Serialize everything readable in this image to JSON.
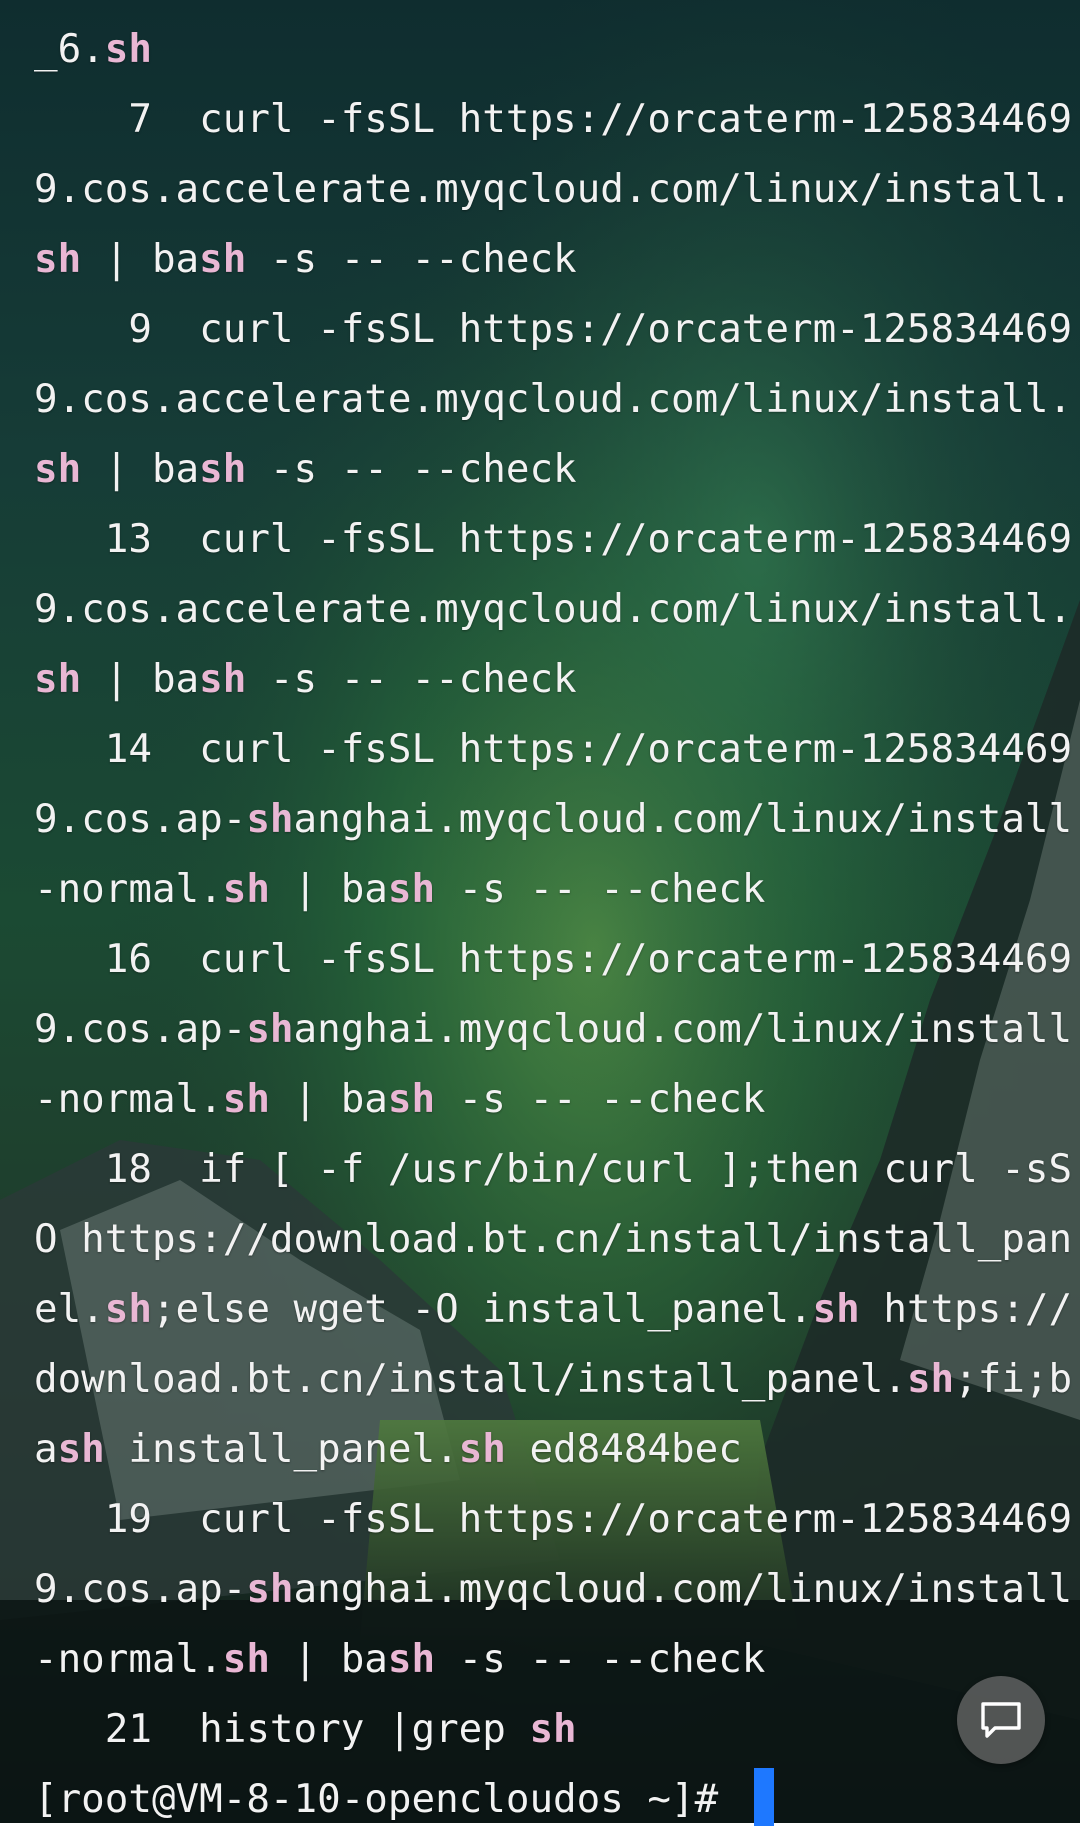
{
  "terminal": {
    "lines": [
      [
        {
          "t": "_6."
        },
        {
          "t": "sh",
          "hl": true
        }
      ],
      [
        {
          "t": "    7  curl -fsSL https://orcaterm-125834469"
        }
      ],
      [
        {
          "t": "9.cos.accelerate.myqcloud.com/linux/install."
        }
      ],
      [
        {
          "t": "sh",
          "hl": true
        },
        {
          "t": " | ba"
        },
        {
          "t": "sh",
          "hl": true
        },
        {
          "t": " -s -- --check"
        }
      ],
      [
        {
          "t": "    9  curl -fsSL https://orcaterm-125834469"
        }
      ],
      [
        {
          "t": "9.cos.accelerate.myqcloud.com/linux/install."
        }
      ],
      [
        {
          "t": "sh",
          "hl": true
        },
        {
          "t": " | ba"
        },
        {
          "t": "sh",
          "hl": true
        },
        {
          "t": " -s -- --check"
        }
      ],
      [
        {
          "t": "   13  curl -fsSL https://orcaterm-125834469"
        }
      ],
      [
        {
          "t": "9.cos.accelerate.myqcloud.com/linux/install."
        }
      ],
      [
        {
          "t": "sh",
          "hl": true
        },
        {
          "t": " | ba"
        },
        {
          "t": "sh",
          "hl": true
        },
        {
          "t": " -s -- --check"
        }
      ],
      [
        {
          "t": "   14  curl -fsSL https://orcaterm-125834469"
        }
      ],
      [
        {
          "t": "9.cos.ap-"
        },
        {
          "t": "sh",
          "hl": true
        },
        {
          "t": "anghai.myqcloud.com/linux/install"
        }
      ],
      [
        {
          "t": "-normal."
        },
        {
          "t": "sh",
          "hl": true
        },
        {
          "t": " | ba"
        },
        {
          "t": "sh",
          "hl": true
        },
        {
          "t": " -s -- --check"
        }
      ],
      [
        {
          "t": "   16  curl -fsSL https://orcaterm-125834469"
        }
      ],
      [
        {
          "t": "9.cos.ap-"
        },
        {
          "t": "sh",
          "hl": true
        },
        {
          "t": "anghai.myqcloud.com/linux/install"
        }
      ],
      [
        {
          "t": "-normal."
        },
        {
          "t": "sh",
          "hl": true
        },
        {
          "t": " | ba"
        },
        {
          "t": "sh",
          "hl": true
        },
        {
          "t": " -s -- --check"
        }
      ],
      [
        {
          "t": "   18  if [ -f /usr/bin/curl ];then curl -sS"
        }
      ],
      [
        {
          "t": "O https://download.bt.cn/install/install_pan"
        }
      ],
      [
        {
          "t": "el."
        },
        {
          "t": "sh",
          "hl": true
        },
        {
          "t": ";else wget -O install_panel."
        },
        {
          "t": "sh",
          "hl": true
        },
        {
          "t": " https://"
        }
      ],
      [
        {
          "t": "download.bt.cn/install/install_panel."
        },
        {
          "t": "sh",
          "hl": true
        },
        {
          "t": ";fi;b"
        }
      ],
      [
        {
          "t": "a"
        },
        {
          "t": "sh",
          "hl": true
        },
        {
          "t": " install_panel."
        },
        {
          "t": "sh",
          "hl": true
        },
        {
          "t": " ed8484bec"
        }
      ],
      [
        {
          "t": "   19  curl -fsSL https://orcaterm-125834469"
        }
      ],
      [
        {
          "t": "9.cos.ap-"
        },
        {
          "t": "sh",
          "hl": true
        },
        {
          "t": "anghai.myqcloud.com/linux/install"
        }
      ],
      [
        {
          "t": "-normal."
        },
        {
          "t": "sh",
          "hl": true
        },
        {
          "t": " | ba"
        },
        {
          "t": "sh",
          "hl": true
        },
        {
          "t": " -s -- --check"
        }
      ],
      [
        {
          "t": "   21  history |grep "
        },
        {
          "t": "sh",
          "hl": true
        }
      ]
    ],
    "prompt": "[root@VM-8-10-opencloudos ~]# "
  },
  "colors": {
    "text": "#f2f2f2",
    "highlight": "#e9b7d4",
    "cursor": "#1e78ff",
    "chat_button": "#6e6e6e"
  },
  "chat_button": {
    "icon": "chat-bubble-icon"
  }
}
